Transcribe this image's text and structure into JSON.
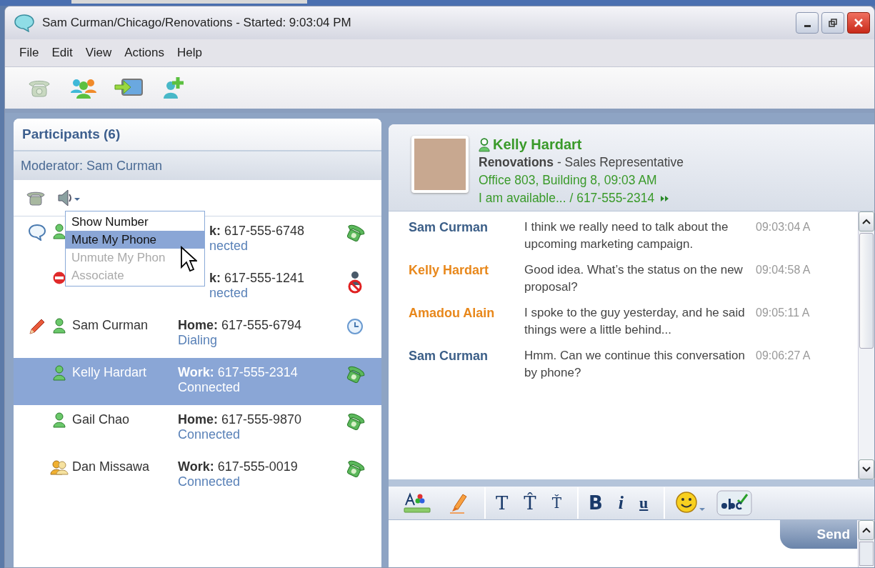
{
  "window": {
    "title": "Sam Curman/Chicago/Renovations - Started: 9:03:04 PM"
  },
  "menu_bar": [
    "File",
    "Edit",
    "View",
    "Actions",
    "Help"
  ],
  "participants": {
    "title": "Participants (6)",
    "moderator": "Moderator: Sam Curman",
    "rows": [
      {
        "kind": "available",
        "in_chat": true,
        "editing": false,
        "phone_label": "k:",
        "number": "617-555-6748",
        "status": "nected",
        "call_blocked": false,
        "call_pending": false,
        "selected": false
      },
      {
        "kind": "dnd",
        "in_chat": false,
        "editing": false,
        "phone_label": "k:",
        "number": "617-555-1241",
        "status": "nected",
        "call_blocked": true,
        "call_pending": false,
        "selected": false
      },
      {
        "kind": "available",
        "in_chat": false,
        "editing": true,
        "name": "Sam Curman",
        "phone_label": "Home:",
        "number": "617-555-6794",
        "status": "Dialing",
        "call_blocked": false,
        "call_pending": true,
        "selected": false
      },
      {
        "kind": "available",
        "in_chat": false,
        "editing": false,
        "name": "Kelly Hardart",
        "phone_label": "Work:",
        "number": "617-555-2314",
        "status": "Connected",
        "call_blocked": false,
        "call_pending": false,
        "selected": true
      },
      {
        "kind": "available",
        "in_chat": false,
        "editing": false,
        "name": "Gail Chao",
        "phone_label": "Home:",
        "number": "617-555-9870",
        "status": "Connected",
        "call_blocked": false,
        "call_pending": false,
        "selected": false
      },
      {
        "kind": "group",
        "in_chat": false,
        "editing": false,
        "name": "Dan Missawa",
        "phone_label": "Work:",
        "number": "617-555-0019",
        "status": "Connected",
        "call_blocked": false,
        "call_pending": false,
        "selected": false
      }
    ]
  },
  "context_menu": [
    {
      "label": "Show Number",
      "selected": false,
      "disabled": false
    },
    {
      "label": "Mute My Phone",
      "selected": true,
      "disabled": false
    },
    {
      "label": "Unmute My Phon",
      "selected": false,
      "disabled": true
    },
    {
      "label": "Associate",
      "selected": false,
      "disabled": true
    }
  ],
  "contact": {
    "name": "Kelly Hardart",
    "title": "**Renovations** - Sales Representative",
    "location": "Office 803, Building 8, 09:03 AM",
    "status": "I am available... / 617-555-2314"
  },
  "messages": [
    {
      "sender": "Sam Curman",
      "color": "#3c5f88",
      "text": "I think we really need to talk about the upcoming marketing campaign.",
      "time": "09:03:04 A"
    },
    {
      "sender": "Kelly Hardart",
      "color": "#e8881c",
      "text": "Good idea. What’s the status on the new proposal?",
      "time": "09:04:58 A"
    },
    {
      "sender": "Amadou Alain",
      "color": "#e8881c",
      "text": "I spoke to the guy yesterday, and he said things were a little behind...",
      "time": "09:05:11 A"
    },
    {
      "sender": "Sam Curman",
      "color": "#3c5f88",
      "text": "Hmm. Can we continue this conversation by phone?",
      "time": "09:06:27 A"
    }
  ],
  "font_buttons": [
    "T",
    "T̂",
    "Ť"
  ],
  "style_buttons": [
    {
      "kind": "bold",
      "label": "B"
    },
    {
      "kind": "italic",
      "label": "i"
    },
    {
      "kind": "underline",
      "label": "u"
    }
  ],
  "send_button": "Send"
}
